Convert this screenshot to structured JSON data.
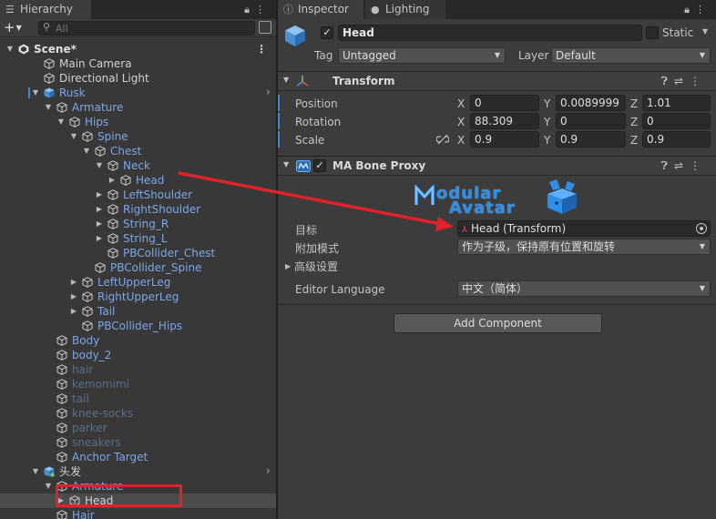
{
  "hierarchy": {
    "tab_label": "Hierarchy",
    "search_placeholder": "All",
    "rows": [
      {
        "label": "Scene*",
        "indent": 0,
        "arrow": "down",
        "icon": "unity-scene-icon",
        "color": "bold",
        "kebab": true,
        "selected": false
      },
      {
        "label": "Main Camera",
        "indent": 2,
        "arrow": "",
        "icon": "cube",
        "color": "white"
      },
      {
        "label": "Directional Light",
        "indent": 2,
        "arrow": "",
        "icon": "cube",
        "color": "white"
      },
      {
        "label": "Rusk",
        "indent": 2,
        "arrow": "down",
        "icon": "prefab",
        "color": "blue",
        "chevron": true,
        "marker": true
      },
      {
        "label": "Armature",
        "indent": 3,
        "arrow": "down",
        "icon": "cube",
        "color": "blue"
      },
      {
        "label": "Hips",
        "indent": 4,
        "arrow": "down",
        "icon": "cube",
        "color": "blue"
      },
      {
        "label": "Spine",
        "indent": 5,
        "arrow": "down",
        "icon": "cube",
        "color": "blue"
      },
      {
        "label": "Chest",
        "indent": 6,
        "arrow": "down",
        "icon": "cube",
        "color": "blue"
      },
      {
        "label": "Neck",
        "indent": 7,
        "arrow": "down",
        "icon": "cube",
        "color": "blue"
      },
      {
        "label": "Head",
        "indent": 8,
        "arrow": "right",
        "icon": "cube",
        "color": "blue"
      },
      {
        "label": "LeftShoulder",
        "indent": 7,
        "arrow": "right",
        "icon": "cube",
        "color": "blue"
      },
      {
        "label": "RightShoulder",
        "indent": 7,
        "arrow": "right",
        "icon": "cube",
        "color": "blue"
      },
      {
        "label": "String_R",
        "indent": 7,
        "arrow": "right",
        "icon": "cube",
        "color": "blue"
      },
      {
        "label": "String_L",
        "indent": 7,
        "arrow": "right",
        "icon": "cube",
        "color": "blue"
      },
      {
        "label": "PBCollider_Chest",
        "indent": 7,
        "arrow": "",
        "icon": "cube",
        "color": "blue"
      },
      {
        "label": "PBCollider_Spine",
        "indent": 6,
        "arrow": "",
        "icon": "cube",
        "color": "blue"
      },
      {
        "label": "LeftUpperLeg",
        "indent": 5,
        "arrow": "right",
        "icon": "cube",
        "color": "blue"
      },
      {
        "label": "RightUpperLeg",
        "indent": 5,
        "arrow": "right",
        "icon": "cube",
        "color": "blue"
      },
      {
        "label": "Tail",
        "indent": 5,
        "arrow": "right",
        "icon": "cube",
        "color": "blue"
      },
      {
        "label": "PBCollider_Hips",
        "indent": 5,
        "arrow": "",
        "icon": "cube",
        "color": "blue"
      },
      {
        "label": "Body",
        "indent": 3,
        "arrow": "",
        "icon": "cube",
        "color": "blue"
      },
      {
        "label": "body_2",
        "indent": 3,
        "arrow": "",
        "icon": "cube",
        "color": "blue"
      },
      {
        "label": "hair",
        "indent": 3,
        "arrow": "",
        "icon": "cube",
        "color": "dim"
      },
      {
        "label": "kemomimi",
        "indent": 3,
        "arrow": "",
        "icon": "cube",
        "color": "dim"
      },
      {
        "label": "tail",
        "indent": 3,
        "arrow": "",
        "icon": "cube",
        "color": "dim"
      },
      {
        "label": "knee-socks",
        "indent": 3,
        "arrow": "",
        "icon": "cube",
        "color": "dim"
      },
      {
        "label": "parker",
        "indent": 3,
        "arrow": "",
        "icon": "cube",
        "color": "dim"
      },
      {
        "label": "sneakers",
        "indent": 3,
        "arrow": "",
        "icon": "cube",
        "color": "dim"
      },
      {
        "label": "Anchor Target",
        "indent": 3,
        "arrow": "",
        "icon": "cube",
        "color": "blue"
      },
      {
        "label": "头发",
        "indent": 2,
        "arrow": "down",
        "icon": "prefab-variant",
        "color": "white",
        "chevron": true
      },
      {
        "label": "Armature",
        "indent": 3,
        "arrow": "down",
        "icon": "cube",
        "color": "blue"
      },
      {
        "label": "Head",
        "indent": 4,
        "arrow": "right",
        "icon": "cube",
        "color": "white",
        "selected": true
      },
      {
        "label": "Hair",
        "indent": 3,
        "arrow": "",
        "icon": "cube",
        "color": "blue"
      }
    ]
  },
  "inspector": {
    "tabs": {
      "inspector": "Inspector",
      "lighting": "Lighting"
    },
    "object_name": "Head",
    "static_label": "Static",
    "tag_label": "Tag",
    "tag_value": "Untagged",
    "layer_label": "Layer",
    "layer_value": "Default",
    "transform": {
      "title": "Transform",
      "position_label": "Position",
      "rotation_label": "Rotation",
      "scale_label": "Scale",
      "position": {
        "x": "0",
        "y": "0.0089999",
        "z": "1.01"
      },
      "rotation": {
        "x": "88.309",
        "y": "0",
        "z": "0"
      },
      "scale": {
        "x": "0.9",
        "y": "0.9",
        "z": "0.9"
      }
    },
    "bone_proxy": {
      "title": "MA Bone Proxy",
      "logo_line1": "odular",
      "logo_line2": "Avatar",
      "target_label": "目标",
      "target_value": "Head (Transform)",
      "attach_label": "附加模式",
      "attach_value": "作为子级，保持原有位置和旋转",
      "advanced_label": "高级设置",
      "language_label": "Editor Language",
      "language_value": "中文（简体）"
    },
    "add_component": "Add Component"
  },
  "colors": {
    "accent_blue": "#3d85d8",
    "annotation_red": "#e0232a",
    "prefab_text": "#7ba7e8"
  }
}
